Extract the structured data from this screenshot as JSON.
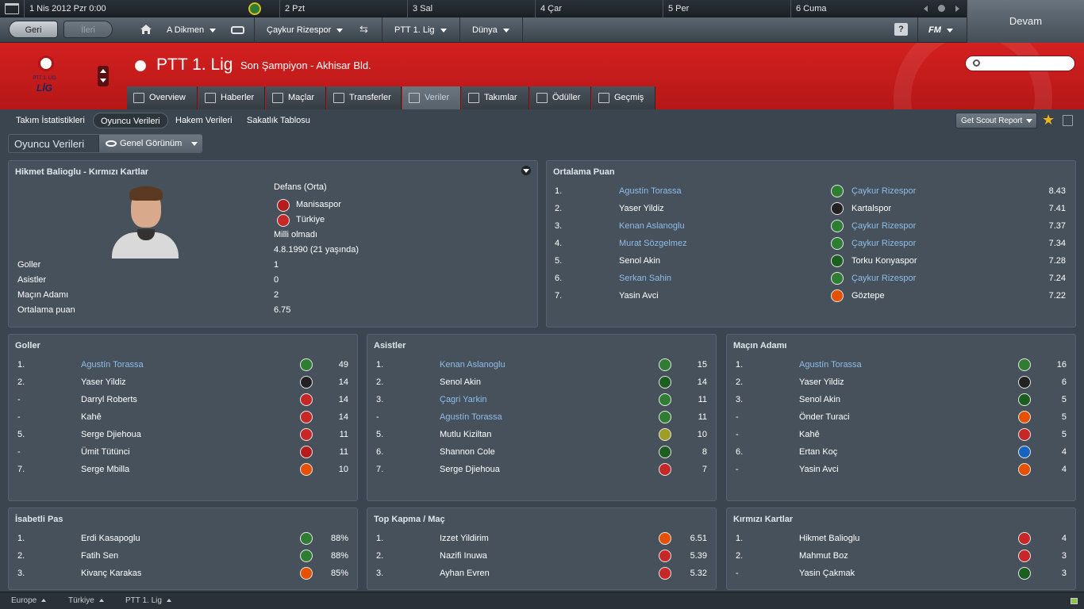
{
  "calendar": {
    "date": "1 Nis 2012",
    "weekday": "Pzr",
    "time": "0:00",
    "days": [
      "2 Pzt",
      "3 Sal",
      "4 Çar",
      "5 Per",
      "6 Cuma"
    ]
  },
  "continue_label": "Devam",
  "nav": {
    "back": "Geri",
    "forward": "İleri",
    "manager": "A Dikmen",
    "club": "Çaykur Rizespor",
    "league": "PTT 1. Lig",
    "world": "Dünya",
    "help": "?",
    "fm": "FM"
  },
  "header": {
    "title": "PTT 1. Lig",
    "subtitle": "Son Şampiyon - Akhisar Bld.",
    "logo_text": "LİG",
    "logo_subtext": "PTT 1. LİG",
    "search_placeholder": ""
  },
  "tabs": [
    {
      "label": "Overview"
    },
    {
      "label": "Haberler"
    },
    {
      "label": "Maçlar"
    },
    {
      "label": "Transferler"
    },
    {
      "label": "Veriler"
    },
    {
      "label": "Takımlar"
    },
    {
      "label": "Ödüller"
    },
    {
      "label": "Geçmiş"
    }
  ],
  "subnav": {
    "items": [
      "Takım İstatistikleri",
      "Oyuncu Verileri",
      "Hakem Verileri",
      "Sakatlık Tablosu"
    ],
    "scout": "Get Scout Report"
  },
  "section": {
    "title": "Oyuncu Verileri",
    "view": "Genel Görünüm"
  },
  "player_panel": {
    "title": "Hikmet Balioglu - Kırmızı Kartlar",
    "position": "Defans (Orta)",
    "club": "Manisaspor",
    "nation": "Türkiye",
    "caps": "Milli olmadı",
    "dob": "4.8.1990 (21 yaşında)",
    "stats": [
      {
        "label": "Goller",
        "value": "1"
      },
      {
        "label": "Asistler",
        "value": "0"
      },
      {
        "label": "Maçın Adamı",
        "value": "2"
      },
      {
        "label": "Ortalama puan",
        "value": "6.75"
      }
    ]
  },
  "avg_rating": {
    "title": "Ortalama Puan",
    "rows": [
      {
        "rank": "1.",
        "name": "Agustín Torassa",
        "link": true,
        "club": "Çaykur Rizespor",
        "club_link": true,
        "value": "8.43",
        "color": "#2e7d32"
      },
      {
        "rank": "2.",
        "name": "Yaser Yildiz",
        "link": false,
        "club": "Kartalspor",
        "club_link": false,
        "value": "7.41",
        "color": "#222222"
      },
      {
        "rank": "3.",
        "name": "Kenan Aslanoglu",
        "link": true,
        "club": "Çaykur Rizespor",
        "club_link": true,
        "value": "7.37",
        "color": "#2e7d32"
      },
      {
        "rank": "4.",
        "name": "Murat Sözgelmez",
        "link": true,
        "club": "Çaykur Rizespor",
        "club_link": true,
        "value": "7.34",
        "color": "#2e7d32"
      },
      {
        "rank": "5.",
        "name": "Senol Akin",
        "link": false,
        "club": "Torku Konyaspor",
        "club_link": false,
        "value": "7.28",
        "color": "#1b5e20"
      },
      {
        "rank": "6.",
        "name": "Serkan Sahin",
        "link": true,
        "club": "Çaykur Rizespor",
        "club_link": true,
        "value": "7.24",
        "color": "#2e7d32"
      },
      {
        "rank": "7.",
        "name": "Yasin Avci",
        "link": false,
        "club": "Göztepe",
        "club_link": false,
        "value": "7.22",
        "color": "#e65100"
      }
    ]
  },
  "goals": {
    "title": "Goller",
    "rows": [
      {
        "rank": "1.",
        "name": "Agustín Torassa",
        "link": true,
        "value": "49",
        "color": "#2e7d32"
      },
      {
        "rank": "2.",
        "name": "Yaser Yildiz",
        "link": false,
        "value": "14",
        "color": "#222222"
      },
      {
        "rank": "-",
        "name": "Darryl Roberts",
        "link": false,
        "value": "14",
        "color": "#c62828"
      },
      {
        "rank": "-",
        "name": "Kahê",
        "link": false,
        "value": "14",
        "color": "#c62828"
      },
      {
        "rank": "5.",
        "name": "Serge Djiehoua",
        "link": false,
        "value": "11",
        "color": "#c62828"
      },
      {
        "rank": "-",
        "name": "Ümit Tütünci",
        "link": false,
        "value": "11",
        "color": "#b71c1c"
      },
      {
        "rank": "7.",
        "name": "Serge Mbilla",
        "link": false,
        "value": "10",
        "color": "#e65100"
      }
    ]
  },
  "assists": {
    "title": "Asistler",
    "rows": [
      {
        "rank": "1.",
        "name": "Kenan Aslanoglu",
        "link": true,
        "value": "15",
        "color": "#2e7d32"
      },
      {
        "rank": "2.",
        "name": "Senol Akin",
        "link": false,
        "value": "14",
        "color": "#1b5e20"
      },
      {
        "rank": "3.",
        "name": "Çagri Yarkin",
        "link": true,
        "value": "11",
        "color": "#2e7d32"
      },
      {
        "rank": "-",
        "name": "Agustín Torassa",
        "link": true,
        "value": "11",
        "color": "#2e7d32"
      },
      {
        "rank": "5.",
        "name": "Mutlu Kiziltan",
        "link": false,
        "value": "10",
        "color": "#9e9d24"
      },
      {
        "rank": "6.",
        "name": "Shannon Cole",
        "link": false,
        "value": "8",
        "color": "#1b5e20"
      },
      {
        "rank": "7.",
        "name": "Serge Djiehoua",
        "link": false,
        "value": "7",
        "color": "#c62828"
      }
    ]
  },
  "motm": {
    "title": "Maçın Adamı",
    "rows": [
      {
        "rank": "1.",
        "name": "Agustín Torassa",
        "link": true,
        "value": "16",
        "color": "#2e7d32"
      },
      {
        "rank": "2.",
        "name": "Yaser Yildiz",
        "link": false,
        "value": "6",
        "color": "#222222"
      },
      {
        "rank": "3.",
        "name": "Senol Akin",
        "link": false,
        "value": "5",
        "color": "#1b5e20"
      },
      {
        "rank": "-",
        "name": "Önder Turaci",
        "link": false,
        "value": "5",
        "color": "#e65100"
      },
      {
        "rank": "-",
        "name": "Kahê",
        "link": false,
        "value": "5",
        "color": "#c62828"
      },
      {
        "rank": "6.",
        "name": "Ertan Koç",
        "link": false,
        "value": "4",
        "color": "#1565c0"
      },
      {
        "rank": "-",
        "name": "Yasin Avci",
        "link": false,
        "value": "4",
        "color": "#e65100"
      }
    ]
  },
  "passes": {
    "title": "İsabetli Pas",
    "rows": [
      {
        "rank": "1.",
        "name": "Erdi Kasapoglu",
        "link": false,
        "value": "88%",
        "color": "#2e7d32"
      },
      {
        "rank": "2.",
        "name": "Fatih Sen",
        "link": false,
        "value": "88%",
        "color": "#2e7d32"
      },
      {
        "rank": "3.",
        "name": "Kivanç Karakas",
        "link": false,
        "value": "85%",
        "color": "#e65100"
      }
    ]
  },
  "tackles": {
    "title": "Top Kapma / Maç",
    "rows": [
      {
        "rank": "1.",
        "name": "Izzet Yildirim",
        "link": false,
        "value": "6.51",
        "color": "#e65100"
      },
      {
        "rank": "2.",
        "name": "Nazifi Inuwa",
        "link": false,
        "value": "5.39",
        "color": "#c62828"
      },
      {
        "rank": "3.",
        "name": "Ayhan Evren",
        "link": false,
        "value": "5.32",
        "color": "#c62828"
      }
    ]
  },
  "red_cards": {
    "title": "Kırmızı Kartlar",
    "rows": [
      {
        "rank": "1.",
        "name": "Hikmet Balioglu",
        "link": false,
        "value": "4",
        "color": "#c62828"
      },
      {
        "rank": "2.",
        "name": "Mahmut Boz",
        "link": false,
        "value": "3",
        "color": "#c62828"
      },
      {
        "rank": "-",
        "name": "Yasin Çakmak",
        "link": false,
        "value": "3",
        "color": "#1b5e20"
      }
    ]
  },
  "footer": [
    "Europe",
    "Türkiye",
    "PTT 1. Lig"
  ]
}
